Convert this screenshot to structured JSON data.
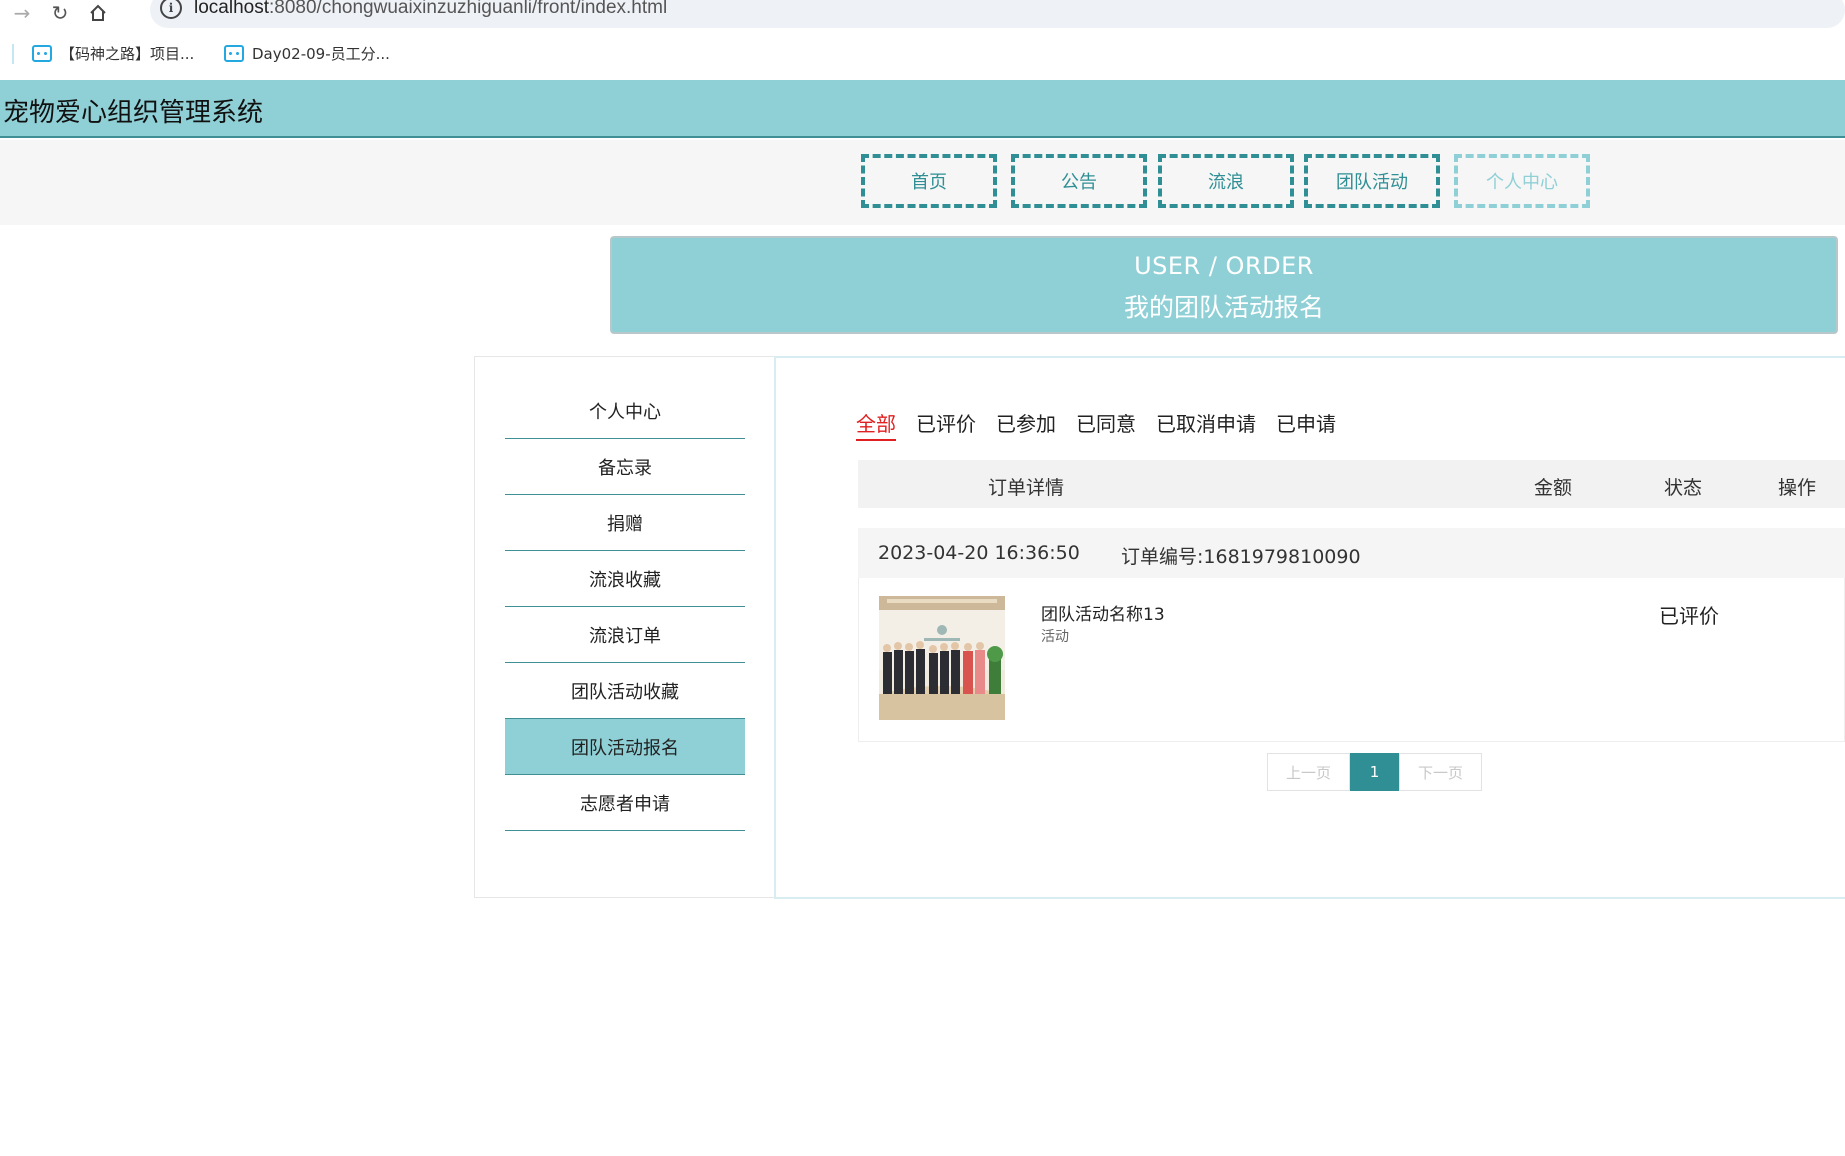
{
  "browser": {
    "url_host": "localhost",
    "url_rest": ":8080/chongwuaixinzuzhiguanli/front/index.html",
    "bookmarks": [
      "【码神之路】项目...",
      "Day02-09-员工分..."
    ]
  },
  "site": {
    "title": "宠物爱心组织管理系统",
    "nav": [
      "首页",
      "公告",
      "流浪",
      "团队活动",
      "个人中心"
    ],
    "nav_active": "个人中心"
  },
  "banner": {
    "en": "USER / ORDER",
    "cn": "我的团队活动报名"
  },
  "side_menu": {
    "items": [
      "个人中心",
      "备忘录",
      "捐赠",
      "流浪收藏",
      "流浪订单",
      "团队活动收藏",
      "团队活动报名",
      "志愿者申请"
    ],
    "active": "团队活动报名"
  },
  "tabs": {
    "items": [
      "全部",
      "已评价",
      "已参加",
      "已同意",
      "已取消申请",
      "已申请"
    ],
    "active": "全部"
  },
  "table": {
    "headers": [
      "订单详情",
      "金额",
      "状态",
      "操作"
    ]
  },
  "order": {
    "date": "2023-04-20 16:36:50",
    "order_no": "订单编号:1681979810090",
    "item_name": "团队活动名称13",
    "item_type": "活动",
    "status": "已评价"
  },
  "pager": {
    "prev": "上一页",
    "current": "1",
    "next": "下一页"
  },
  "colors": {
    "header_bg": "#8fd0d7",
    "accent": "#2f8f94",
    "active_tab": "#e02020"
  }
}
